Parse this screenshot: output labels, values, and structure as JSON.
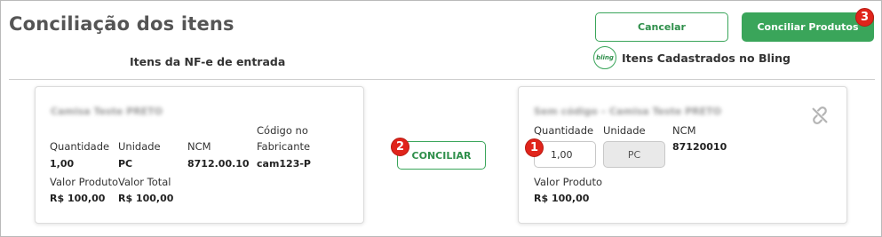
{
  "header": {
    "title": "Conciliação dos itens",
    "cancel_label": "Cancelar",
    "conciliar_produtos_label": "Conciliar Produtos"
  },
  "columns": {
    "left_title": "Itens da NF-e de entrada",
    "right_title": "Itens Cadastrados no Bling",
    "bling_logo_text": "bling"
  },
  "nfe_item": {
    "name": "Camisa Teste PRETO",
    "quantidade_label": "Quantidade",
    "quantidade_value": "1,00",
    "unidade_label": "Unidade",
    "unidade_value": "PC",
    "ncm_label": "NCM",
    "ncm_value": "8712.00.10",
    "codigo_label_1": "Código no",
    "codigo_label_2": "Fabricante",
    "codigo_value": "cam123-P",
    "valor_produto_label": "Valor Produto",
    "valor_produto_value": "R$ 100,00",
    "valor_total_label": "Valor Total",
    "valor_total_value": "R$ 100,00"
  },
  "conciliar_label": "CONCILIAR",
  "bling_item": {
    "name": "Sem código – Camisa Teste PRETO",
    "quantidade_label": "Quantidade",
    "quantidade_value": "1,00",
    "unidade_label": "Unidade",
    "unidade_value": "PC",
    "ncm_label": "NCM",
    "ncm_value": "87120010",
    "valor_produto_label": "Valor Produto",
    "valor_produto_value": "R$ 100,00"
  },
  "markers": {
    "m1": "1",
    "m2": "2",
    "m3": "3"
  },
  "icons": {
    "unlink": "unlink-icon",
    "bling": "bling-logo-icon"
  },
  "colors": {
    "accent": "#3aa55a",
    "marker": "#e0241b"
  }
}
